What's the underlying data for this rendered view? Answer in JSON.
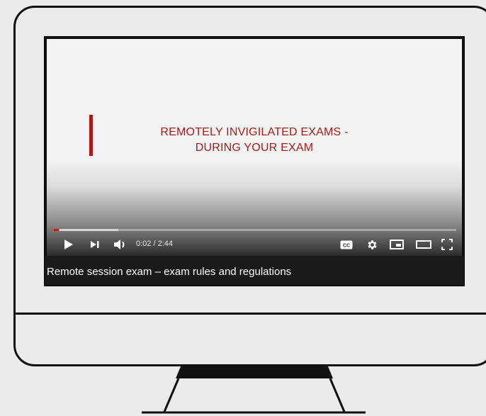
{
  "video": {
    "title_line1": "REMOTELY INVIGILATED EXAMS -",
    "title_line2": "DURING YOUR EXAM",
    "accent_color": "#b21717"
  },
  "player": {
    "current_time": "0:02",
    "duration": "2:44",
    "time_display": "0:02 / 2:44",
    "progress_fraction": 0.012,
    "buffered_fraction": 0.16,
    "progress_color": "#ff0000"
  },
  "controls": {
    "icons": [
      "play-icon",
      "next-icon",
      "volume-icon",
      "captions-icon",
      "settings-icon",
      "miniplayer-icon",
      "theater-icon",
      "fullscreen-icon"
    ]
  },
  "caption": {
    "text": "Remote session exam – exam rules and regulations"
  }
}
